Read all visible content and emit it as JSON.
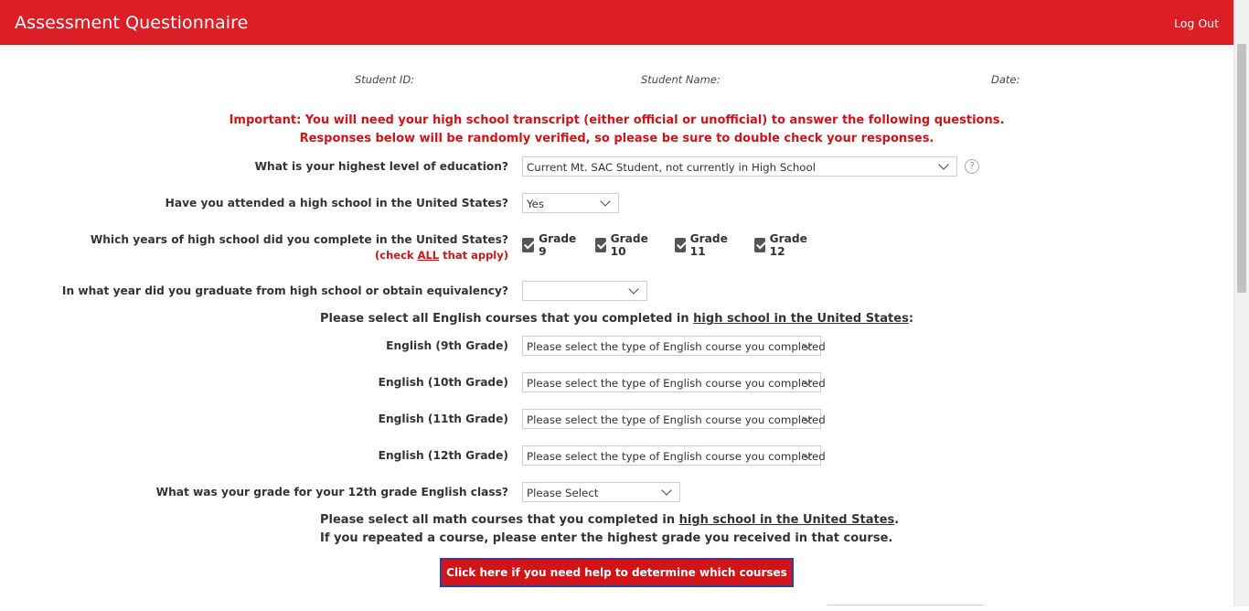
{
  "header": {
    "title": "Assessment Questionnaire",
    "logout": "Log Out"
  },
  "meta": {
    "student_id": "Student ID:",
    "student_name": "Student Name:",
    "date": "Date:"
  },
  "important": {
    "line1": "Important: You will need your high school transcript (either official or unofficial) to answer the following questions.",
    "line2": "Responses below will be randomly verified, so please be sure to double check your responses."
  },
  "education": {
    "label": "What is your highest level of education?",
    "value": "Current Mt. SAC Student, not currently in High School",
    "help": "?"
  },
  "attended": {
    "label": "Have you attended a high school in the United States?",
    "value": "Yes"
  },
  "years": {
    "label": "Which years of high school did you complete in the United States?",
    "sub_prefix": "(check ",
    "sub_all": "ALL",
    "sub_suffix": " that apply)",
    "options": [
      {
        "label": "Grade 9",
        "checked": true
      },
      {
        "label": "Grade 10",
        "checked": true
      },
      {
        "label": "Grade 11",
        "checked": true
      },
      {
        "label": "Grade 12",
        "checked": true
      }
    ]
  },
  "graduated": {
    "label": "In what year did you graduate from high school or obtain equivalency?",
    "value": ""
  },
  "english_section": {
    "prefix": "Please select all English courses that you completed in ",
    "underlined": "high school in the United States",
    "suffix": ":"
  },
  "english": [
    {
      "label": "English (9th Grade)",
      "value": "Please select the type of English course you completed"
    },
    {
      "label": "English (10th Grade)",
      "value": "Please select the type of English course you completed"
    },
    {
      "label": "English (11th Grade)",
      "value": "Please select the type of English course you completed"
    },
    {
      "label": "English (12th Grade)",
      "value": "Please select the type of English course you completed"
    }
  ],
  "grade12": {
    "label": "What was your grade for your 12th grade English class?",
    "value": "Please Select"
  },
  "math_section": {
    "prefix": "Please select all math courses that you completed in ",
    "underlined": "high school in the United States",
    "suffix": ".",
    "line2": "If you repeated a course, please enter the highest grade you received in that course."
  },
  "help_button": "Click here if you need help to determine which courses to check",
  "colors": {
    "brand_red": "#dc1f26",
    "important_red": "#d01418",
    "checkbox": "#555555"
  }
}
